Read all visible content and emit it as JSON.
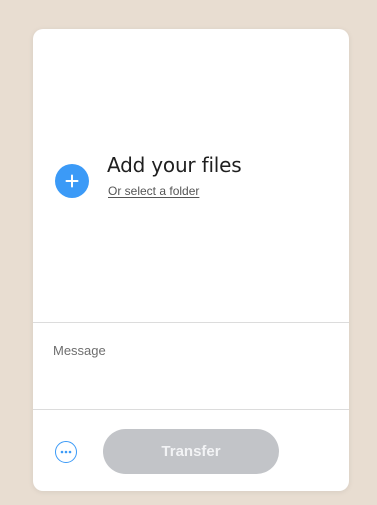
{
  "upload": {
    "title": "Add your files",
    "select_folder_link": "Or select a folder",
    "add_icon": "plus-icon"
  },
  "message": {
    "placeholder": "Message",
    "value": ""
  },
  "footer": {
    "options_icon": "ellipsis-icon",
    "transfer_label": "Transfer",
    "transfer_enabled": false
  },
  "colors": {
    "accent": "#3b9af7",
    "background": "#e8ddd1",
    "card": "#ffffff",
    "button_disabled": "#c2c4c8"
  }
}
